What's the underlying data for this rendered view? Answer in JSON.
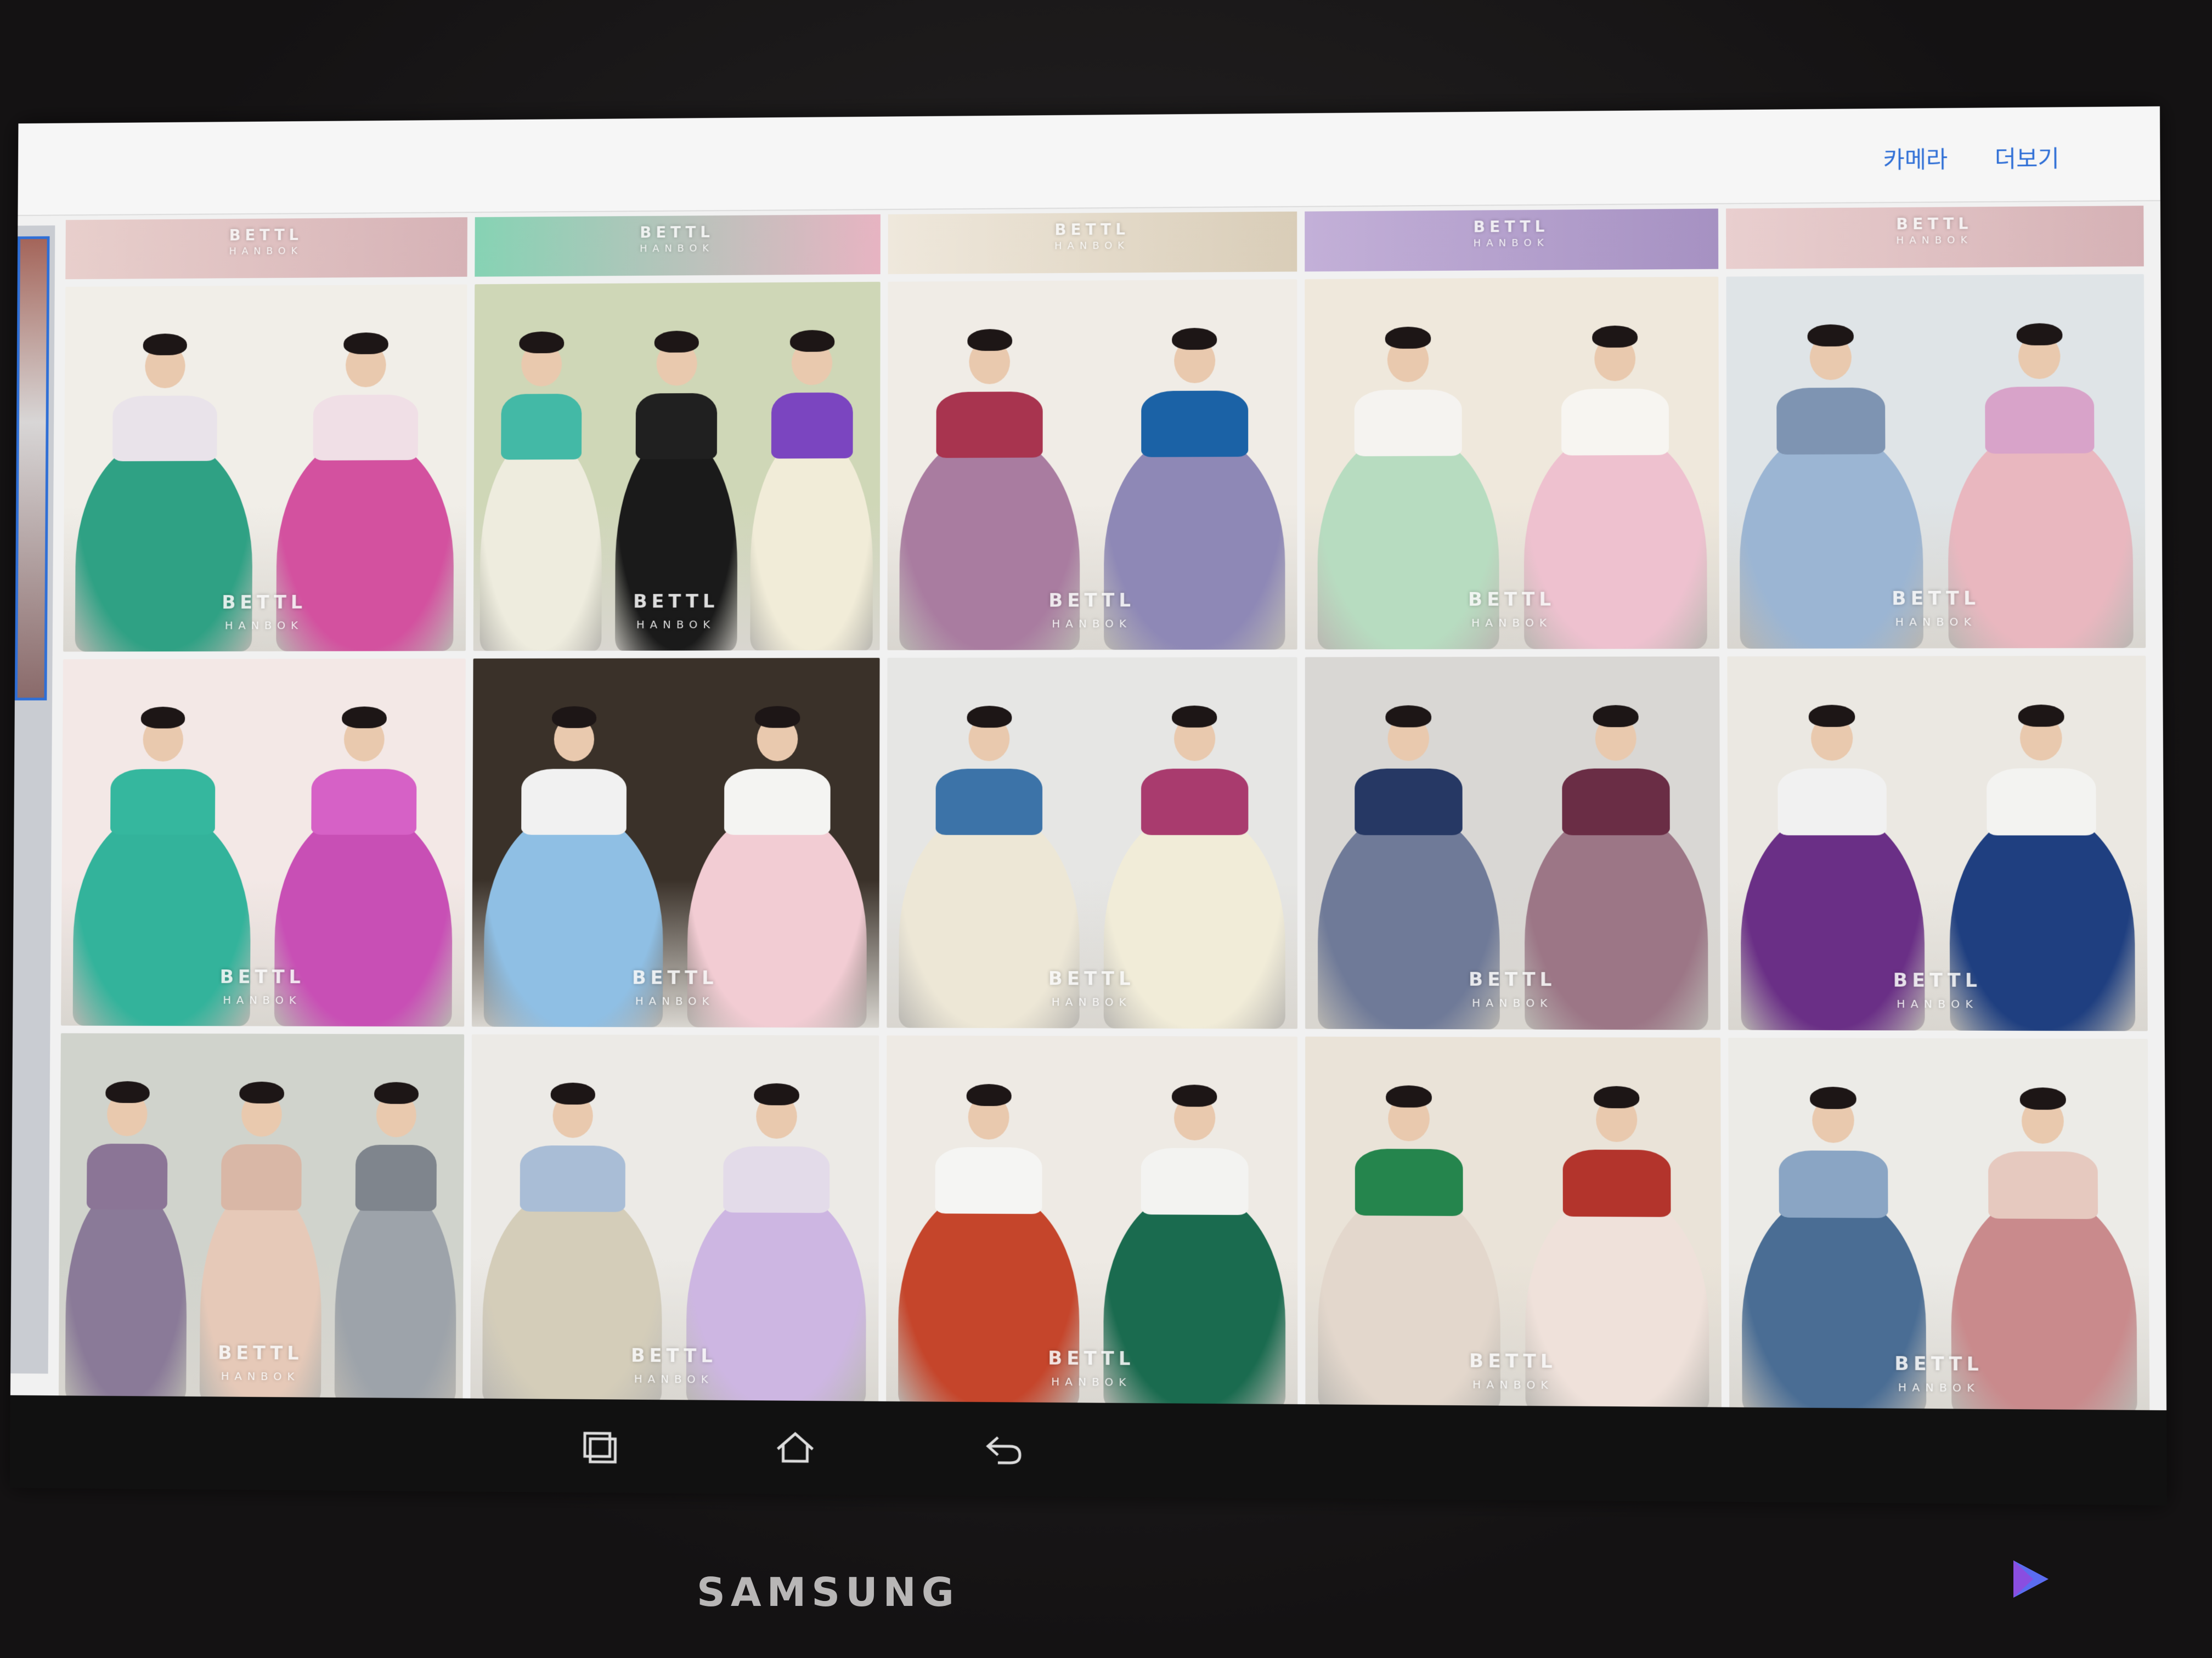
{
  "topbar": {
    "camera_label": "카메라",
    "more_label": "더보기"
  },
  "device": {
    "brand": "SAMSUNG"
  },
  "gallery": {
    "watermark": "BETTL",
    "watermark_sub": "HANBOK",
    "header_strips": [
      {
        "bg": "#e8cfcc",
        "bg2": "#d6b2b6"
      },
      {
        "bg": "#86d3b4",
        "bg2": "#e7b4c2"
      },
      {
        "bg": "#efe8dc",
        "bg2": "#d9cdb8"
      },
      {
        "bg": "#c3b0d8",
        "bg2": "#a691c2"
      },
      {
        "bg": "#e9cfcf",
        "bg2": "#d5b1b5"
      }
    ],
    "tiles": [
      {
        "bg": "#f1eee8",
        "colors": [
          "#2fa184",
          "#d3519f"
        ],
        "tops": [
          "#e9e3ea",
          "#f0dfe6"
        ]
      },
      {
        "bg": "#cfd7b7",
        "colors": [
          "#eeecde",
          "#1a1a1a",
          "#f1ecd8"
        ],
        "tops": [
          "#43b9a6",
          "#202020",
          "#7b45c0"
        ]
      },
      {
        "bg": "#f0ece6",
        "colors": [
          "#a97ca0",
          "#8e88b6"
        ],
        "tops": [
          "#a8344f",
          "#1b62a6"
        ]
      },
      {
        "bg": "#efe8dc",
        "colors": [
          "#b7dcc0",
          "#eec1cf"
        ],
        "tops": [
          "#f5f3f0",
          "#f7f5f1"
        ]
      },
      {
        "bg": "#dfe4e7",
        "colors": [
          "#9bb5d3",
          "#e9b7bf"
        ],
        "tops": [
          "#7e94b2",
          "#d8a3c9"
        ]
      },
      {
        "bg": "#f3e8e6",
        "colors": [
          "#33b39b",
          "#c84fb5"
        ],
        "tops": [
          "#35b79e",
          "#d661c6"
        ]
      },
      {
        "bg": "#3a3129",
        "colors": [
          "#8fbfe4",
          "#f2ccd3"
        ],
        "tops": [
          "#f1f1f1",
          "#f4f4f2"
        ]
      },
      {
        "bg": "#e6e6e4",
        "colors": [
          "#ede7d6",
          "#f1ecd8"
        ],
        "tops": [
          "#3c73a8",
          "#a93b6e"
        ]
      },
      {
        "bg": "#d9d7d4",
        "colors": [
          "#6f7a98",
          "#9c7686"
        ],
        "tops": [
          "#263864",
          "#6a2d45"
        ]
      },
      {
        "bg": "#ebe8e2",
        "colors": [
          "#6a2f86",
          "#1f3f80"
        ],
        "tops": [
          "#f1f1f1",
          "#f3f3f1"
        ]
      },
      {
        "bg": "#d0d3cc",
        "colors": [
          "#8a7a98",
          "#e6c9b8",
          "#9da3aa"
        ],
        "tops": [
          "#8b7596",
          "#d9b7a6",
          "#7f858d"
        ]
      },
      {
        "bg": "#eceae6",
        "colors": [
          "#d4cdb9",
          "#cdb6e2"
        ],
        "tops": [
          "#a9bdd6",
          "#e3dbe9"
        ]
      },
      {
        "bg": "#eeeae4",
        "colors": [
          "#c5452b",
          "#1a6b4f"
        ],
        "tops": [
          "#f5f5f3",
          "#f3f3f1"
        ]
      },
      {
        "bg": "#eae3d8",
        "colors": [
          "#e3d7cc",
          "#efe1da"
        ],
        "tops": [
          "#25854d",
          "#b3342c"
        ]
      },
      {
        "bg": "#ecebe7",
        "colors": [
          "#4a6d94",
          "#c98a8c"
        ],
        "tops": [
          "#8aa5c4",
          "#e6c9bf"
        ]
      }
    ]
  }
}
